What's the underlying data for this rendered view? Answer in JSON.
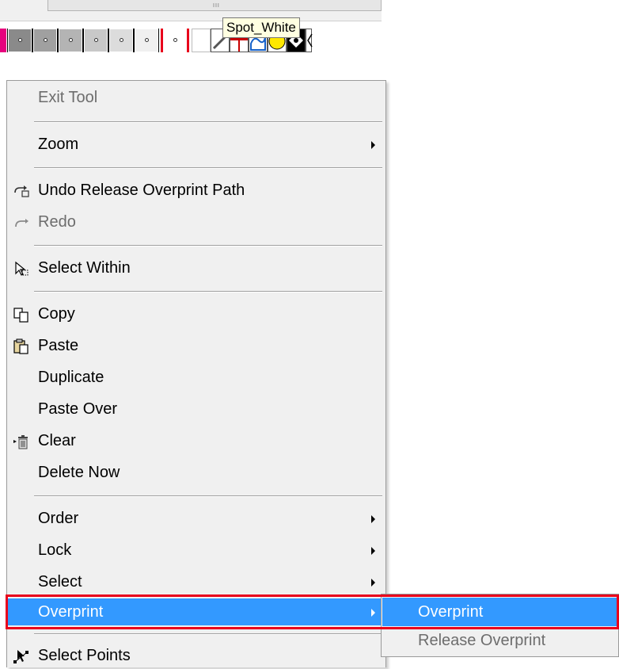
{
  "toolbar": {
    "scroll_grip": "III",
    "swatches": [
      {
        "name": "magenta",
        "color": "#e6007e"
      },
      {
        "name": "gray-1",
        "color": "#8a8a8a"
      },
      {
        "name": "gray-2",
        "color": "#a0a0a0"
      },
      {
        "name": "gray-3",
        "color": "#b4b4b4"
      },
      {
        "name": "gray-4",
        "color": "#c8c8c8"
      },
      {
        "name": "gray-5",
        "color": "#e0e0e0"
      },
      {
        "name": "spot-white",
        "color": "#ffffff",
        "selected": true
      }
    ],
    "tooltip": "Spot_White"
  },
  "menu": {
    "items": [
      {
        "label": "Exit Tool",
        "disabled": true
      },
      {
        "label": "Zoom",
        "submenu": true
      },
      {
        "label": "Undo Release Overprint Path",
        "icon": "undo-icon"
      },
      {
        "label": "Redo",
        "disabled": true,
        "icon": "redo-icon"
      },
      {
        "label": "Select Within",
        "icon": "select-within-icon"
      },
      {
        "label": "Copy",
        "icon": "copy-icon"
      },
      {
        "label": "Paste",
        "icon": "paste-icon"
      },
      {
        "label": "Duplicate"
      },
      {
        "label": "Paste Over"
      },
      {
        "label": "Clear",
        "icon": "trash-icon"
      },
      {
        "label": "Delete Now"
      },
      {
        "label": "Order",
        "submenu": true
      },
      {
        "label": "Lock",
        "submenu": true
      },
      {
        "label": "Select",
        "submenu": true
      },
      {
        "label": "Overprint",
        "submenu": true,
        "highlighted": true
      },
      {
        "label": "Select Points",
        "icon": "select-points-icon"
      }
    ]
  },
  "submenu": {
    "items": [
      {
        "label": "Overprint",
        "highlighted": true
      },
      {
        "label": "Release Overprint",
        "disabled": true
      }
    ]
  },
  "colors": {
    "highlight": "#3399ff",
    "annotation_red": "#e8001c",
    "tooltip_bg": "#ffffe1",
    "menu_bg": "#f0f0f0"
  }
}
